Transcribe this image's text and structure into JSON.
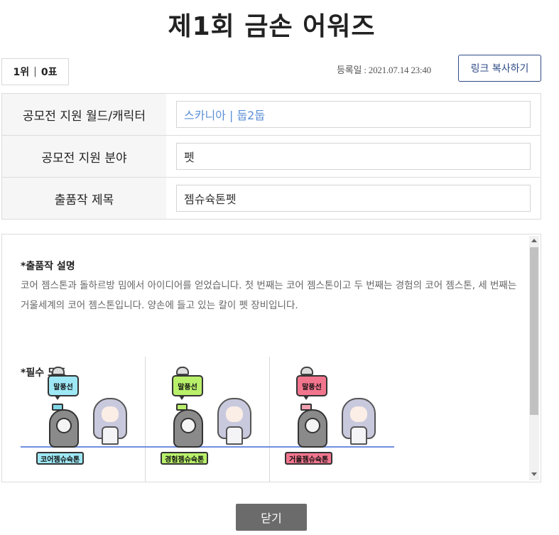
{
  "title": "제1회 금손 어워즈",
  "rank": {
    "rank": "1위",
    "separator": "|",
    "votes": "0표"
  },
  "reg_date": "등록일 : 2021.07.14 23:40",
  "copy_link_label": "링크 복사하기",
  "info": [
    {
      "label": "공모전 지원 월드/캐릭터",
      "value": "스카니아 | 둡2둡"
    },
    {
      "label": "공모전 지원 분야",
      "value": "펫"
    },
    {
      "label": "출품작 제목",
      "value": "젬슈슉톤펫"
    }
  ],
  "description": {
    "heading": "*출품작 설명",
    "text": "코어 젬스톤과 돌하르방 밈에서 아이디어를 얻었습니다. 첫 번째는 코어 젬스톤이고 두 번째는 경험의 코어 젬스톤, 세 번째는 거울세계의 코어 젬스톤입니다. 양손에 들고 있는 칼이 펫 장비입니다.",
    "dots_heading": "*필수 도트"
  },
  "sprites": [
    {
      "bubble": "말풍선",
      "bubble_color": "#9ee8f5",
      "name": "코어젬슈슉톤",
      "name_color": "#9ee8f5",
      "leaf_color": "#7fd8e8"
    },
    {
      "bubble": "말풍선",
      "bubble_color": "#b9f06a",
      "name": "경험젬슈슉톤",
      "name_color": "#b9f06a",
      "leaf_color": "#b9f06a"
    },
    {
      "bubble": "말풍선",
      "bubble_color": "#f2758e",
      "name": "거울젬슈슉톤",
      "name_color": "#f2758e",
      "leaf_color": "#f2a0b0"
    }
  ],
  "close_label": "닫기"
}
